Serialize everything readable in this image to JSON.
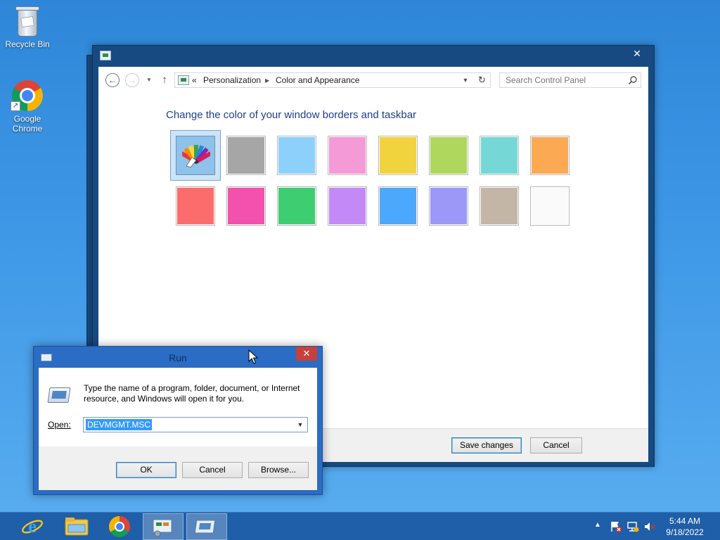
{
  "desktop": {
    "icons": [
      {
        "label": "Recycle Bin",
        "icon": "recycle-bin-icon"
      },
      {
        "label": "Google Chrome",
        "icon": "chrome-icon"
      }
    ]
  },
  "control_panel": {
    "title": "",
    "close_glyph": "✕",
    "breadcrumb": {
      "prefix": "«",
      "items": [
        "Personalization",
        "Color and Appearance"
      ]
    },
    "search_placeholder": "Search Control Panel",
    "heading": "Change the color of your window borders and taskbar",
    "swatches": [
      {
        "color": "#8ec2ea",
        "selected": true,
        "icon": "color-palette-icon"
      },
      {
        "color": "#a6a6a6"
      },
      {
        "color": "#8dd0fb"
      },
      {
        "color": "#f49ad6"
      },
      {
        "color": "#f1d33d"
      },
      {
        "color": "#afd75d"
      },
      {
        "color": "#76d7d7"
      },
      {
        "color": "#fba953"
      },
      {
        "color": "#fd6c6c"
      },
      {
        "color": "#f450ad"
      },
      {
        "color": "#3fcd72"
      },
      {
        "color": "#c38af7"
      },
      {
        "color": "#4ba8fb"
      },
      {
        "color": "#9b98f8"
      },
      {
        "color": "#c3b6a7"
      },
      {
        "color": "#fafafa"
      }
    ],
    "footer": {
      "save_label": "Save changes",
      "cancel_label": "Cancel"
    }
  },
  "run_dialog": {
    "title": "Run",
    "close_glyph": "✕",
    "description": "Type the name of a program, folder, document, or Internet resource, and Windows will open it for you.",
    "open_label": "Open:",
    "open_value": "DEVMGMT.MSC",
    "ok_label": "OK",
    "cancel_label": "Cancel",
    "browse_label": "Browse..."
  },
  "taskbar": {
    "buttons": [
      {
        "icon": "internet-explorer-icon",
        "active": false
      },
      {
        "icon": "file-explorer-icon",
        "active": false
      },
      {
        "icon": "chrome-icon",
        "active": false
      },
      {
        "icon": "control-panel-icon",
        "active": true
      },
      {
        "icon": "run-icon",
        "active": true
      }
    ],
    "tray": {
      "icons": [
        "show-hidden-icons-icon",
        "action-center-icon",
        "network-icon",
        "volume-muted-icon"
      ],
      "time": "5:44 AM",
      "date": "9/18/2022"
    }
  },
  "colors": {
    "desktop": "#3d97e6",
    "window_frame": "#174a80",
    "taskbar": "#1f5ea8",
    "heading_text": "#1e3f8a",
    "close_red": "#c7403a",
    "selection": "#3399ff"
  }
}
